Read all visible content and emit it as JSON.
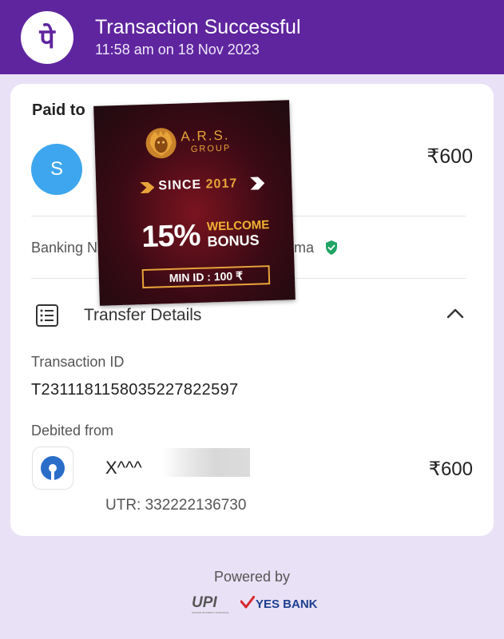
{
  "header": {
    "logo_glyph": "पे",
    "title": "Transaction Successful",
    "datetime": "11:58 am on 18 Nov 2023",
    "color": "#5f259f"
  },
  "paid_to": {
    "label": "Paid to",
    "avatar_initial": "S",
    "avatar_color": "#3ea6ee",
    "amount": "₹600",
    "banking_name_prefix": "Banking N",
    "banking_name_suffix": "ma",
    "verified_icon": "verified-shield-icon"
  },
  "transfer_details": {
    "label": "Transfer Details",
    "icon": "receipt-list-icon",
    "expand_icon": "chevron-up-icon",
    "transaction_id_label": "Transaction ID",
    "transaction_id": "T2311181158035227822597",
    "debited_from_label": "Debited from",
    "bank_icon": "sbi-bank-icon",
    "account_masked": "X^^^",
    "amount": "₹600",
    "utr": "UTR: 332222136730"
  },
  "footer": {
    "powered_by": "Powered by",
    "upi_logo": "UPI",
    "upi_tagline": "UNIFIED PAYMENTS INTERFACE",
    "partner_bank": "YES BANK"
  },
  "advertisement": {
    "brand": "A.R.S.",
    "brand_sub": "GROUP",
    "since_prefix": "SINCE",
    "since_year": "2017",
    "percent": "15%",
    "welcome": "WELCOME",
    "bonus": "BONUS",
    "min_id": "MIN ID : 100 ₹"
  }
}
